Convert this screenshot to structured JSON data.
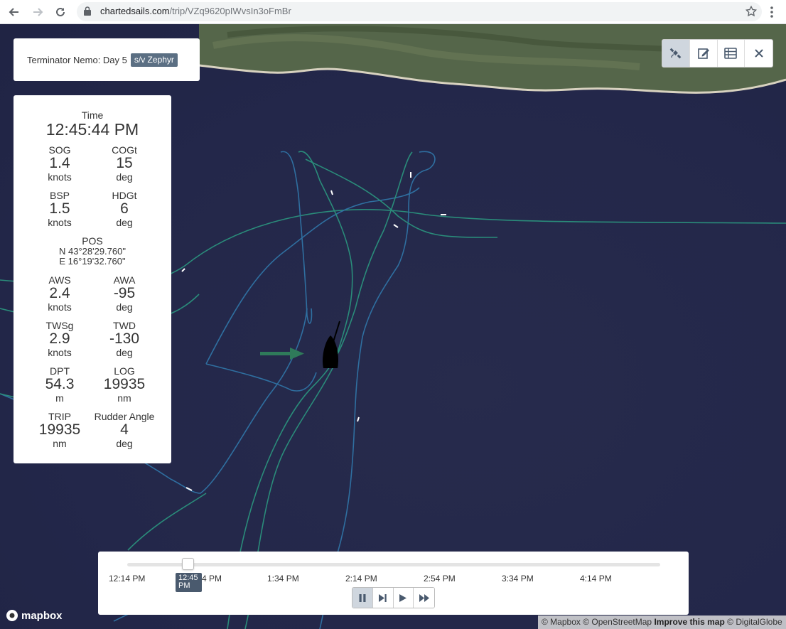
{
  "browser": {
    "url_host": "chartedsails.com",
    "url_path": "/trip/VZq9620pIWvsIn3oFmBr",
    "back_icon": "arrow-left-icon",
    "forward_icon": "arrow-right-icon",
    "reload_icon": "reload-icon",
    "lock_icon": "lock-icon",
    "bookmark_icon": "star-icon",
    "menu_icon": "kebab-menu-icon"
  },
  "title_panel": {
    "title": "Terminator Nemo: Day 5",
    "boat_badge": "s/v Zephyr"
  },
  "toolbar": {
    "buttons": [
      {
        "icon": "satellite-icon",
        "active": true
      },
      {
        "icon": "edit-icon",
        "active": false
      },
      {
        "icon": "table-icon",
        "active": false
      },
      {
        "icon": "close-icon",
        "active": false
      }
    ]
  },
  "instruments": {
    "time": {
      "label": "Time",
      "value": "12:45:44 PM"
    },
    "sog": {
      "label": "SOG",
      "value": "1.4",
      "unit": "knots"
    },
    "cogt": {
      "label": "COGt",
      "value": "15",
      "unit": "deg"
    },
    "bsp": {
      "label": "BSP",
      "value": "1.5",
      "unit": "knots"
    },
    "hdgt": {
      "label": "HDGt",
      "value": "6",
      "unit": "deg"
    },
    "pos": {
      "label": "POS",
      "lat": "N 43°28'29.760\"",
      "lon": "E 16°19'32.760\""
    },
    "aws": {
      "label": "AWS",
      "value": "2.4",
      "unit": "knots"
    },
    "awa": {
      "label": "AWA",
      "value": "-95",
      "unit": "deg"
    },
    "twsg": {
      "label": "TWSg",
      "value": "2.9",
      "unit": "knots"
    },
    "twd": {
      "label": "TWD",
      "value": "-130",
      "unit": "deg"
    },
    "dpt": {
      "label": "DPT",
      "value": "54.3",
      "unit": "m"
    },
    "log": {
      "label": "LOG",
      "value": "19935",
      "unit": "nm"
    },
    "trip": {
      "label": "TRIP",
      "value": "19935",
      "unit": "nm"
    },
    "rudder": {
      "label": "Rudder Angle",
      "value": "4",
      "unit": "deg"
    }
  },
  "timeline": {
    "ticks": [
      "12:14 PM",
      "4 PM",
      "1:34 PM",
      "2:14 PM",
      "2:54 PM",
      "3:34 PM",
      "4:14 PM"
    ],
    "current_line1": "12:45",
    "current_line2": "PM",
    "progress_fraction": 0.11,
    "controls": [
      {
        "icon": "pause-icon",
        "active": true
      },
      {
        "icon": "step-forward-icon",
        "active": false
      },
      {
        "icon": "play-icon",
        "active": false
      },
      {
        "icon": "fast-forward-icon",
        "active": false
      }
    ]
  },
  "map": {
    "logo_text": "mapbox",
    "attribution": {
      "mapbox": "© Mapbox",
      "osm": "© OpenStreetMap",
      "improve": "Improve this map",
      "digitalglobe": "© DigitalGlobe"
    },
    "track_color": "#2a8c7a",
    "track_color_alt": "#2f6fa0",
    "boat_color": "#000000",
    "arrow_color": "#2f7a5a"
  }
}
